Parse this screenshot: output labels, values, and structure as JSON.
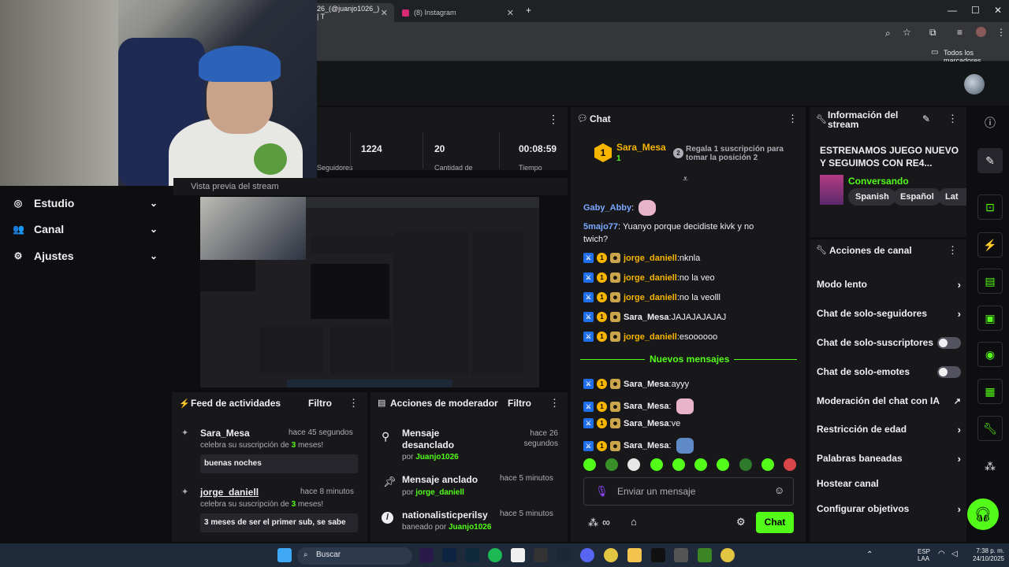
{
  "browser": {
    "tabs": [
      {
        "label": "26_(@juanjo1026_) | T"
      },
      {
        "label": "(8) Instagram"
      }
    ],
    "new_tab": "+",
    "window_controls": [
      "—",
      "☐",
      "✕"
    ],
    "bookmarks_label": "Todos los marcadores"
  },
  "sidebar": {
    "items": [
      {
        "label": "Estudio",
        "icon": "studio-icon"
      },
      {
        "label": "Canal",
        "icon": "users-icon"
      },
      {
        "label": "Ajustes",
        "icon": "gear-icon"
      }
    ]
  },
  "stats": {
    "values": [
      "1224",
      "20",
      "00:08:59"
    ],
    "partial_labels": [
      "Seguidores",
      "Cantidad de",
      "Tiempo"
    ],
    "preview_label": "Vista previa del stream"
  },
  "feed": {
    "title": "Feed de actividades",
    "filter": "Filtro",
    "items": [
      {
        "user": "Sara_Mesa",
        "time": "hace 45 segundos",
        "sub_prefix": "celebra su suscripción de ",
        "months": "3",
        "sub_suffix": " meses!",
        "message": "buenas noches"
      },
      {
        "user": "jorge_daniell",
        "time": "hace 8 minutos",
        "sub_prefix": "celebra su suscripción de ",
        "months": "3",
        "sub_suffix": " meses!",
        "message": "3 meses de ser el primer sub, se sabe"
      }
    ]
  },
  "modactions": {
    "title": "Acciones de moderador",
    "filter": "Filtro",
    "items": [
      {
        "title": "Mensaje desanclado",
        "by_prefix": "por ",
        "by": "Juanjo1026",
        "time": "hace 26 segundos",
        "icon": "unpin-icon"
      },
      {
        "title": "Mensaje anclado",
        "by_prefix": "por ",
        "by": "jorge_daniell",
        "time": "hace 5 minutos",
        "icon": "pin-icon"
      },
      {
        "title": "nationalisticperilsy",
        "by_prefix": "baneado por ",
        "by": "Juanjo1026",
        "time": "hace 5 minutos",
        "icon": "ban-icon"
      }
    ]
  },
  "chat": {
    "title": "Chat",
    "pinned": {
      "rank": "1",
      "user": "Sara_Mesa",
      "count": "1",
      "gift_text": "Regala 1 suscripción para tomar la posición 2",
      "gift_rank": "2"
    },
    "messages_before": [
      {
        "user": "Gaby_Abby",
        "text": "",
        "user_color": "#7aa8ff",
        "emote": true
      },
      {
        "user": "5majo77",
        "text": " Yuanyo porque decidiste kivk y no twich?",
        "user_color": "#7aa8ff",
        "emote": false
      },
      {
        "user": "jorge_daniell",
        "text": " nknla",
        "user_color": "#f7b500",
        "emote": false
      },
      {
        "user": "jorge_daniell",
        "text": " no la veo",
        "user_color": "#f7b500",
        "emote": false
      },
      {
        "user": "jorge_daniell",
        "text": " no la veolll",
        "user_color": "#f7b500",
        "emote": false
      },
      {
        "user": "Sara_Mesa",
        "text": " JAJAJAJAJAJ",
        "user_color": "#efeff1",
        "emote": false
      },
      {
        "user": "jorge_daniell",
        "text": " esoooooo",
        "user_color": "#f7b500",
        "emote": false
      }
    ],
    "new_messages_label": "Nuevos mensajes",
    "messages_after": [
      {
        "user": "Sara_Mesa",
        "text": " ayyy",
        "emote": false
      },
      {
        "user": "Sara_Mesa",
        "text": "",
        "emote": true
      },
      {
        "user": "Sara_Mesa",
        "text": " ve",
        "emote": false
      },
      {
        "user": "Sara_Mesa",
        "text": "",
        "emote": true
      }
    ],
    "input_placeholder": "Enviar un mensaje",
    "send_button": "Chat",
    "colon": ":"
  },
  "info": {
    "title": "Información del stream",
    "stream_title": "ESTRENAMOS JUEGO NUEVO Y SEGUIMOS CON RE4...",
    "category": "Conversando",
    "tags": [
      "Spanish",
      "Español",
      "Lat"
    ]
  },
  "actions": {
    "title": "Acciones de canal",
    "items": [
      {
        "label": "Modo lento",
        "control": "chevron"
      },
      {
        "label": "Chat de solo-seguidores",
        "control": "chevron"
      },
      {
        "label": "Chat de solo-suscriptores",
        "control": "toggle"
      },
      {
        "label": "Chat de solo-emotes",
        "control": "toggle"
      },
      {
        "label": "Moderación del chat con IA",
        "control": "external"
      },
      {
        "label": "Restricción de edad",
        "control": "chevron"
      },
      {
        "label": "Palabras baneadas",
        "control": "chevron"
      },
      {
        "label": "Hostear canal",
        "control": "none"
      },
      {
        "label": "Configurar objetivos",
        "control": "chevron"
      }
    ]
  },
  "taskbar": {
    "search": "Buscar",
    "lang": "ESP",
    "lang2": "LAA",
    "time": "7:38 p. m.",
    "date": "24/10/2025"
  },
  "colors": {
    "accent": "#53fc18",
    "panel": "#18181b",
    "bg": "#0e0e10"
  }
}
